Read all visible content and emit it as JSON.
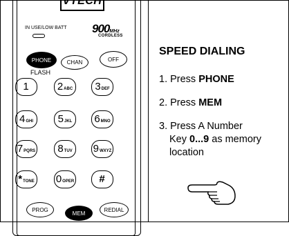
{
  "handset": {
    "brand": "VTECH",
    "in_use_label": "IN USE/LOW BATT",
    "frequency": "900",
    "frequency_unit": "MHz",
    "frequency_sub": "CORDLESS",
    "phone_label": "PHONE",
    "chan_label": "CHAN",
    "off_label": "OFF",
    "flash_label": "FLASH",
    "keys": [
      {
        "digit": "1",
        "letters": ""
      },
      {
        "digit": "2",
        "letters": "ABC"
      },
      {
        "digit": "3",
        "letters": "DEF"
      },
      {
        "digit": "4",
        "letters": "GHI"
      },
      {
        "digit": "5",
        "letters": "JKL"
      },
      {
        "digit": "6",
        "letters": "MNO"
      },
      {
        "digit": "7",
        "letters": "PQRS"
      },
      {
        "digit": "8",
        "letters": "TUV"
      },
      {
        "digit": "9",
        "letters": "WXYZ"
      },
      {
        "digit": "*",
        "letters": "TONE"
      },
      {
        "digit": "0",
        "letters": "OPER"
      },
      {
        "digit": "#",
        "letters": ""
      }
    ],
    "prog_label": "PROG",
    "mem_label": "MEM",
    "redial_label": "REDIAL"
  },
  "instructions": {
    "title": "SPEED DIALING",
    "step1_prefix": "1. Press ",
    "step1_bold": "PHONE",
    "step2_prefix": "2. Press ",
    "step2_bold": "MEM",
    "step3_line1": "3. Press A Number",
    "step3_key": "Key ",
    "step3_bold": "0...9",
    "step3_suffix": " as memory",
    "step3_line3": "location",
    "pointer_icon": "pointing-hand-icon"
  }
}
